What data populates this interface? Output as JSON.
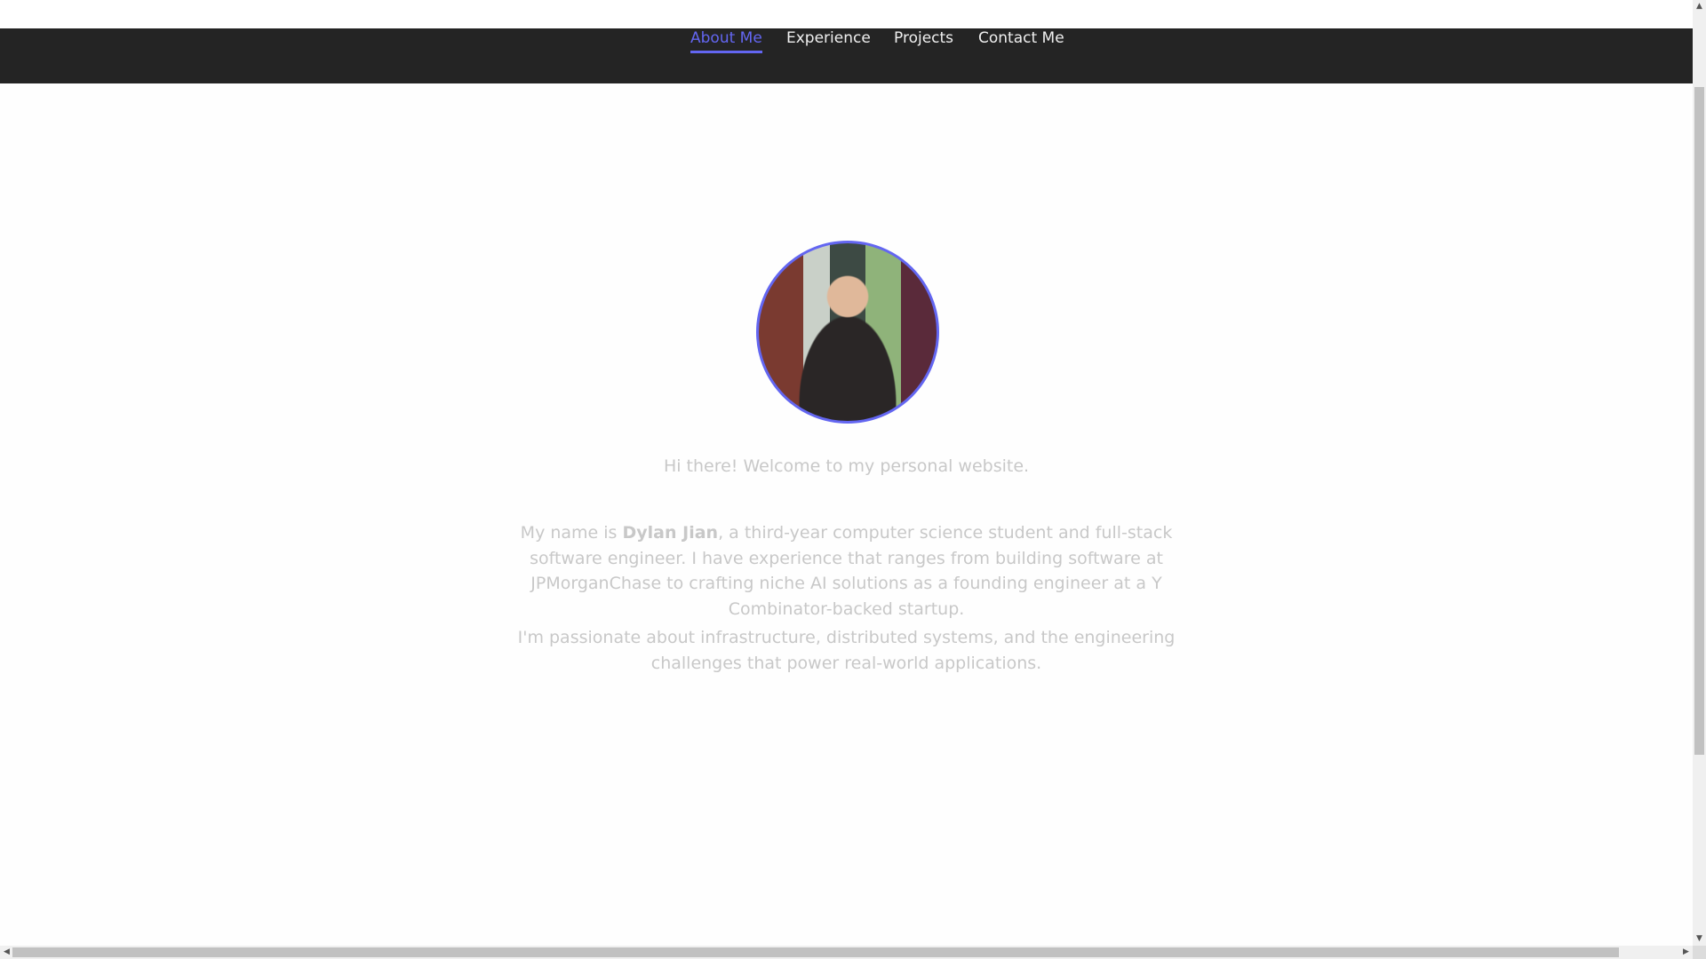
{
  "nav": {
    "items": [
      {
        "label": "About Me",
        "active": true
      },
      {
        "label": "Experience",
        "active": false
      },
      {
        "label": "Projects",
        "active": false
      },
      {
        "label": "Contact Me",
        "active": false
      }
    ]
  },
  "about": {
    "greeting": "Hi there! Welcome to my personal website.",
    "intro_prefix": "My name is ",
    "name": "Dylan Jian",
    "intro_suffix": ", a third-year computer science student and full-stack software engineer. I have experience that ranges from building software at JPMorganChase to crafting niche AI solutions as a founding engineer at a Y Combinator-backed startup.",
    "passion": "I'm passionate about infrastructure, distributed systems, and the engineering challenges that power real-world applications."
  },
  "colors": {
    "accent": "#6366f1",
    "nav_bg": "#242424",
    "text": "#c8c8c8"
  }
}
